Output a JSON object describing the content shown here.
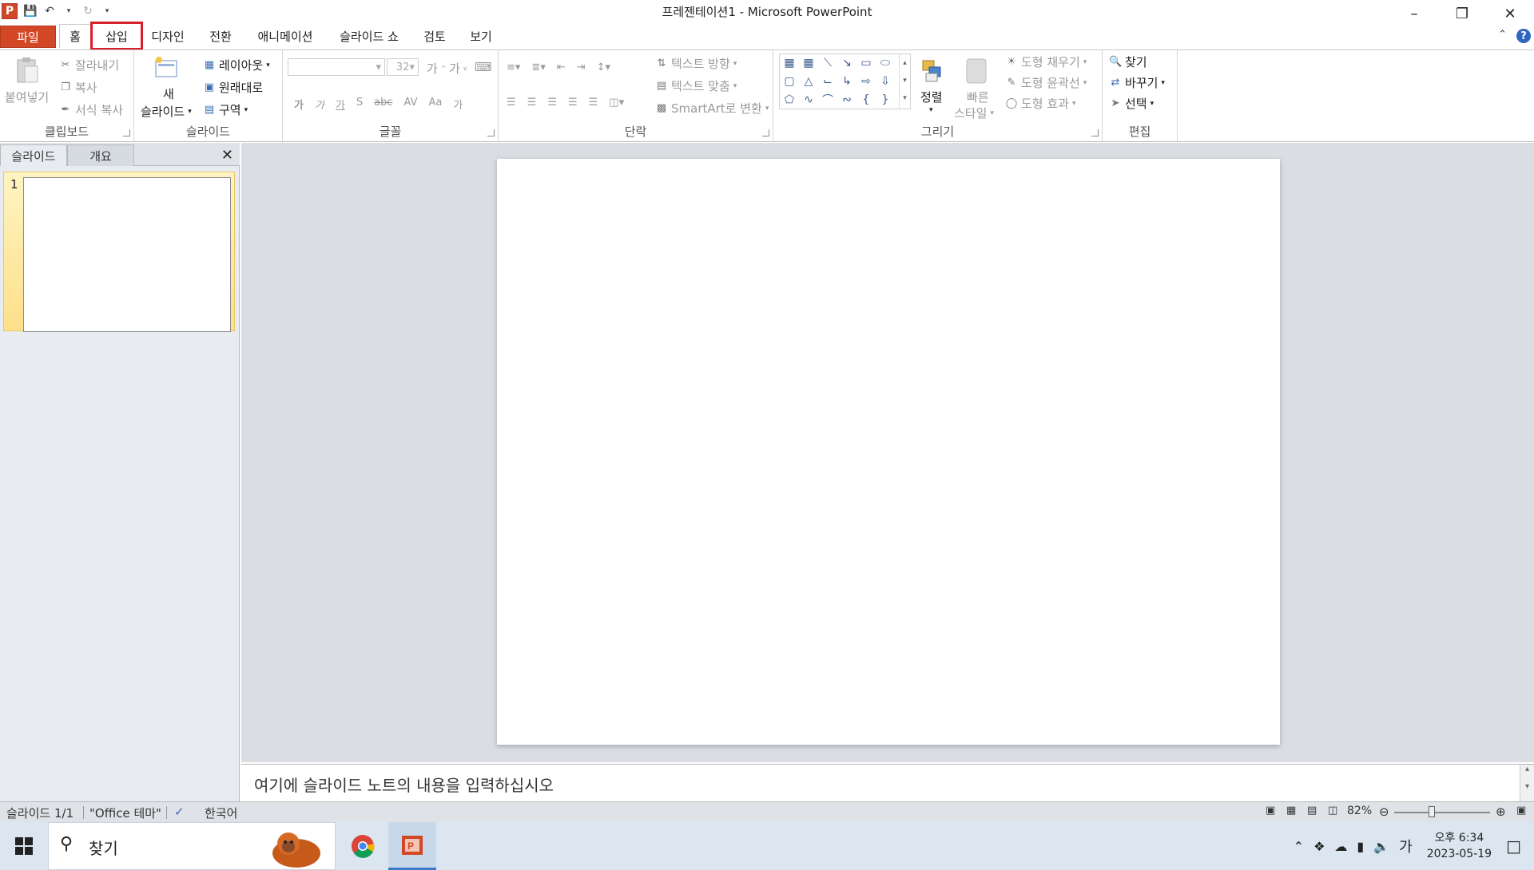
{
  "window": {
    "title": "프레젠테이션1 - Microsoft PowerPoint",
    "app_icon_letter": "P"
  },
  "tabs": {
    "file": "파일",
    "home": "홈",
    "insert": "삽입",
    "design": "디자인",
    "transitions": "전환",
    "animations": "애니메이션",
    "slideshow": "슬라이드 쇼",
    "review": "검토",
    "view": "보기"
  },
  "ribbon": {
    "clipboard": {
      "label": "클립보드",
      "paste": "붙여넣기",
      "cut": "잘라내기",
      "copy": "복사",
      "format_painter": "서식 복사"
    },
    "slides": {
      "label": "슬라이드",
      "new_slide_line1": "새",
      "new_slide_line2": "슬라이드",
      "layout": "레이아웃",
      "reset": "원래대로",
      "section": "구역"
    },
    "font": {
      "label": "글꼴",
      "font_name": "",
      "font_size": "32",
      "bold": "가",
      "italic": "가",
      "underline": "가",
      "shadow": "S",
      "strike": "abc",
      "spacing": "AV",
      "case": "Aa",
      "color": "가"
    },
    "paragraph": {
      "label": "단락",
      "text_direction": "텍스트 방향",
      "align_text": "텍스트 맞춤",
      "smartart": "SmartArt로 변환"
    },
    "drawing": {
      "label": "그리기",
      "arrange": "정렬",
      "quick_styles_line1": "빠른",
      "quick_styles_line2": "스타일",
      "shape_fill": "도형 채우기",
      "shape_outline": "도형 윤곽선",
      "shape_effects": "도형 효과"
    },
    "editing": {
      "label": "편집",
      "find": "찾기",
      "replace": "바꾸기",
      "select": "선택"
    }
  },
  "slides_pane": {
    "tab_slides": "슬라이드",
    "tab_outline": "개요",
    "slide_number": "1"
  },
  "notes": {
    "placeholder": "여기에 슬라이드 노트의 내용을 입력하십시오"
  },
  "status": {
    "slide_info": "슬라이드 1/1",
    "theme": "\"Office 테마\"",
    "language": "한국어",
    "zoom": "82%"
  },
  "taskbar": {
    "search": "찾기",
    "ime": "가",
    "time": "오후 6:34",
    "date": "2023-05-19"
  },
  "colors": {
    "file_tab": "#d24726",
    "highlight_box": "#d6202c",
    "selected_thumb": "#fde08a"
  }
}
